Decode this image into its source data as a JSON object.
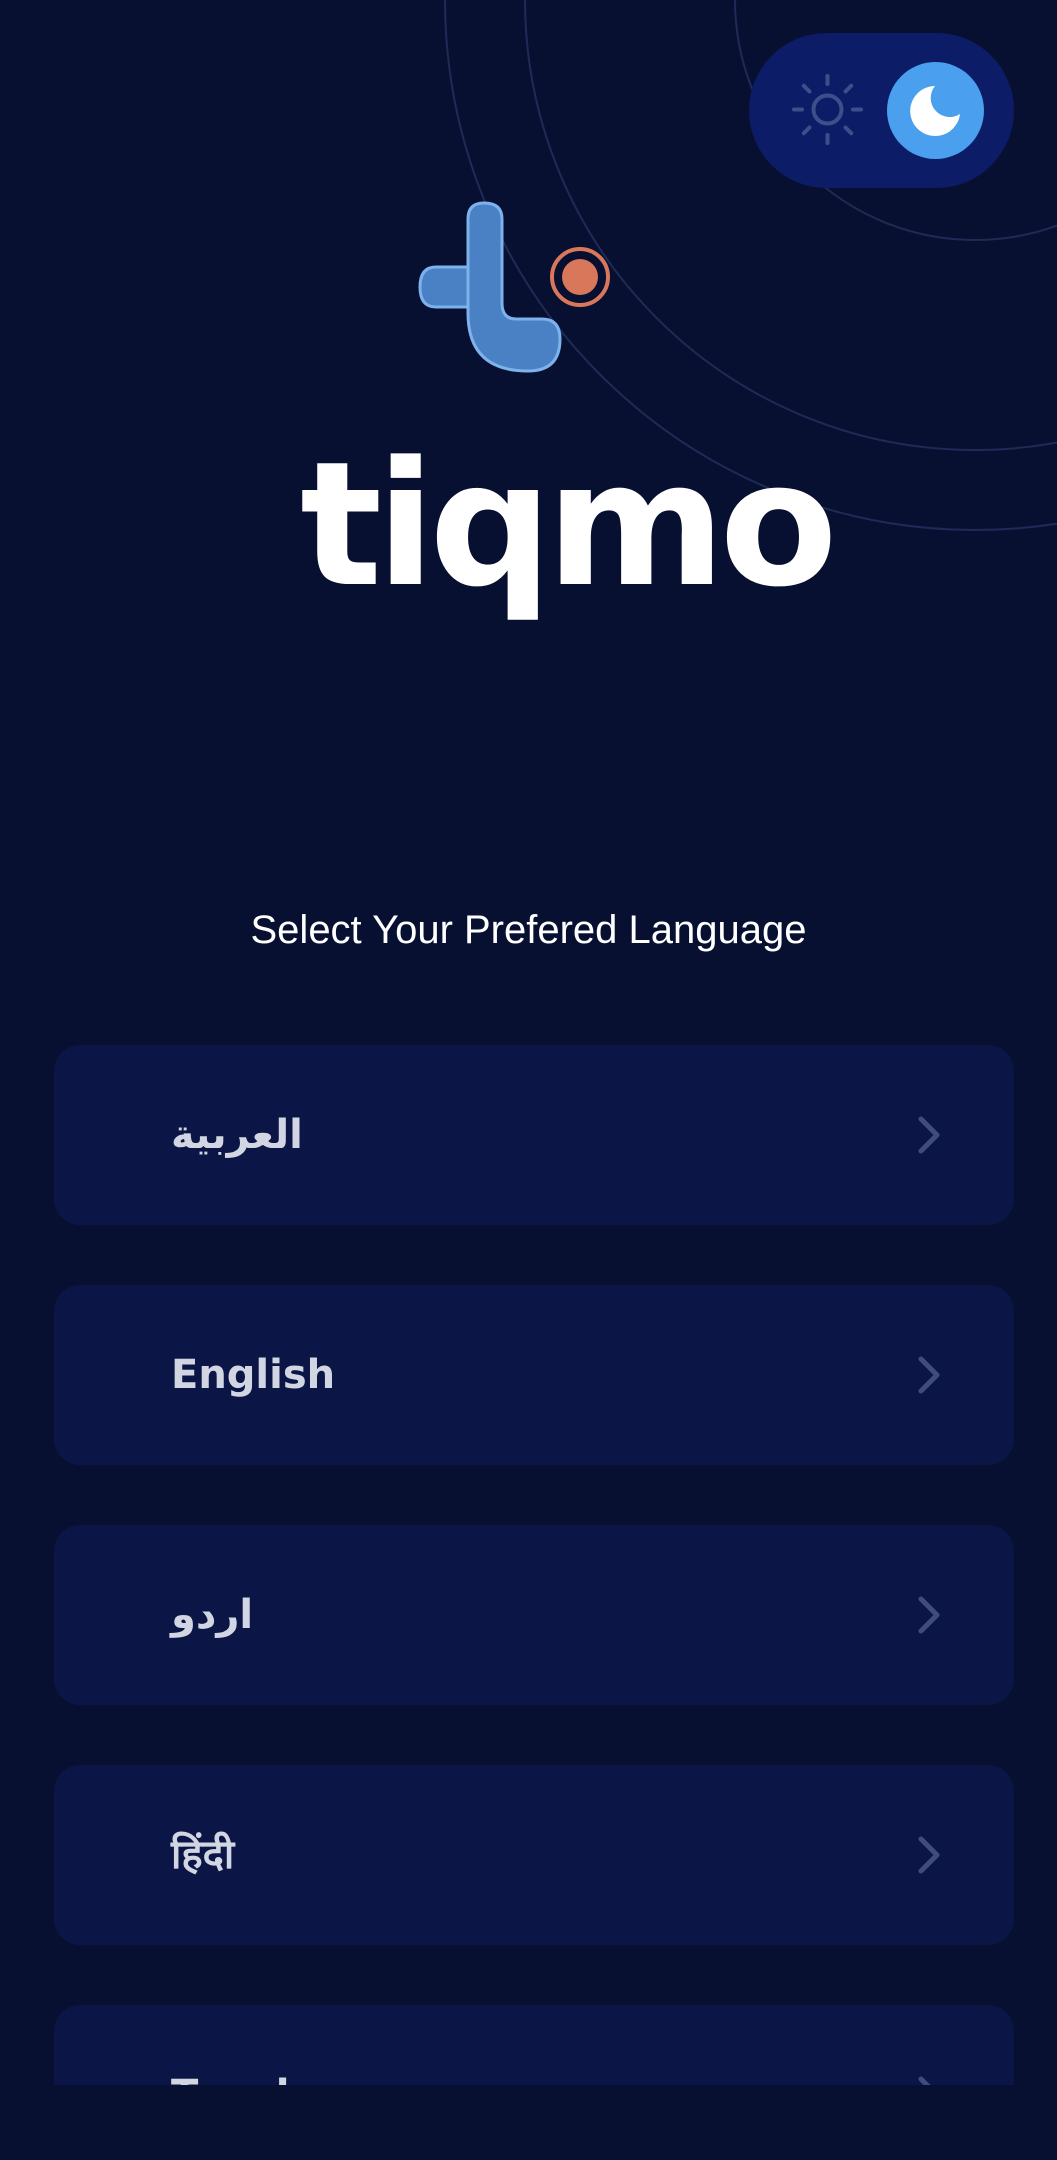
{
  "theme_toggle": {
    "light_icon": "sun-icon",
    "dark_icon": "moon-icon",
    "selected": "dark"
  },
  "brand": {
    "name": "tiqmo",
    "logo_icon": "tiqmo-t-logo-icon",
    "colors": {
      "logo_blue": "#4a80c4",
      "logo_orange": "#d9775a"
    }
  },
  "heading": "Select Your Prefered Language",
  "languages": [
    {
      "label": "العربية"
    },
    {
      "label": "English"
    },
    {
      "label": "اردو"
    },
    {
      "label": "हिंदी"
    },
    {
      "label": "Tagalog"
    }
  ],
  "colors": {
    "background": "#081032",
    "card": "#0b1646",
    "toggle_track": "#0c1c66",
    "toggle_knob": "#4aa0ee",
    "text": "#ffffff",
    "label_text": "#d2d6e2",
    "chevron": "#3e4d7e"
  }
}
